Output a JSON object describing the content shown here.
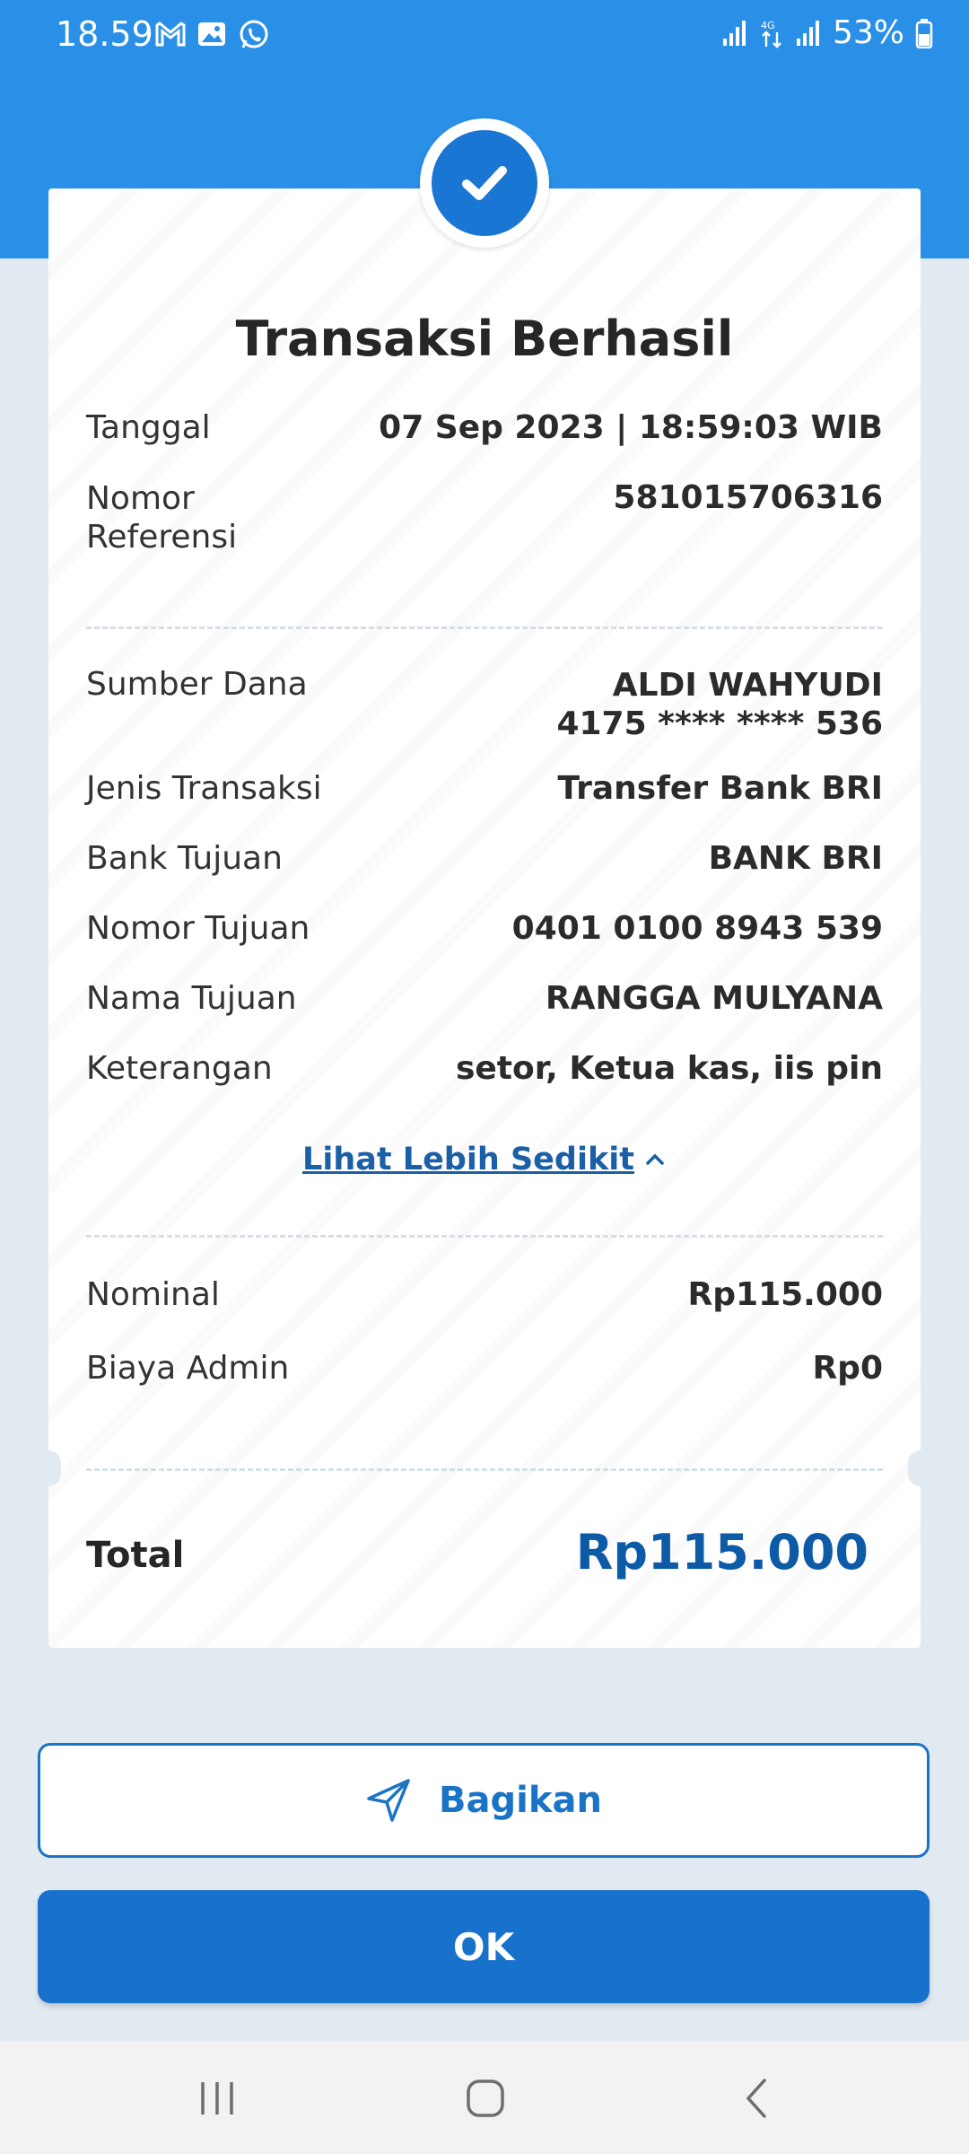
{
  "status_bar": {
    "time": "18.59",
    "battery": "53%"
  },
  "receipt": {
    "title": "Transaksi Berhasil",
    "rows_top": [
      {
        "label": "Tanggal",
        "value": "07 Sep 2023 | 18:59:03 WIB"
      },
      {
        "label": "Nomor Referensi",
        "value": "581015706316"
      }
    ],
    "source": {
      "label": "Sumber Dana",
      "name": "ALDI WAHYUDI",
      "account": "4175 **** **** 536"
    },
    "rows_detail": [
      {
        "label": "Jenis Transaksi",
        "value": "Transfer Bank BRI"
      },
      {
        "label": "Bank Tujuan",
        "value": "BANK BRI"
      },
      {
        "label": "Nomor Tujuan",
        "value": "0401 0100 8943 539"
      },
      {
        "label": "Nama Tujuan",
        "value": "RANGGA MULYANA"
      },
      {
        "label": "Keterangan",
        "value": "setor, Ketua kas, iis pin"
      }
    ],
    "toggle_link": "Lihat Lebih Sedikit",
    "rows_amount": [
      {
        "label": "Nominal",
        "value": "Rp115.000"
      },
      {
        "label": "Biaya Admin",
        "value": "Rp0"
      }
    ],
    "total_label": "Total",
    "total_value": "Rp115.000"
  },
  "actions": {
    "share_label": "Bagikan",
    "ok_label": "OK"
  },
  "icons": {
    "success": "check-circle-icon",
    "share": "send-icon",
    "toggle": "chevron-up-icon",
    "nav": [
      "recent-apps-icon",
      "home-icon",
      "back-icon"
    ]
  },
  "colors": {
    "header_blue": "#2a8fe6",
    "primary": "#1872cc",
    "total_text": "#0d5aa6",
    "background": "#e1e9f1"
  }
}
